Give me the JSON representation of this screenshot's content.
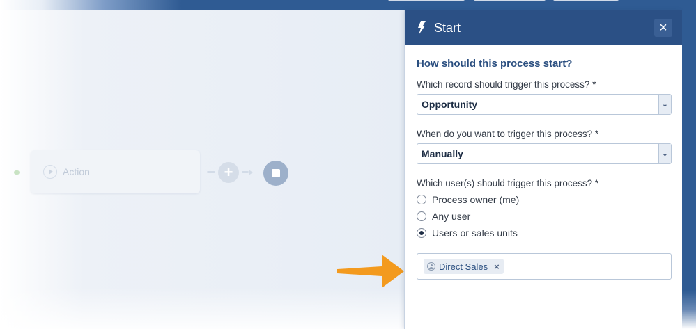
{
  "canvas": {
    "action_label": "Action"
  },
  "panel": {
    "title": "Start",
    "close_label": "×",
    "heading": "How should this process start?",
    "record_label": "Which record should trigger this process? *",
    "record_value": "Opportunity",
    "when_label": "When do you want to trigger this process? *",
    "when_value": "Manually",
    "users_label": "Which user(s) should trigger this process? *",
    "user_options": [
      {
        "label": "Process owner (me)",
        "checked": false
      },
      {
        "label": "Any user",
        "checked": false
      },
      {
        "label": "Users or sales units",
        "checked": true
      }
    ],
    "selected_tags": [
      "Direct Sales"
    ],
    "tag_remove": "×"
  },
  "colors": {
    "header": "#2b5085",
    "accent_text": "#2b4f80",
    "callout": "#f39a1e"
  },
  "icons": {
    "header_icon": "lightning-bolt-icon",
    "close_icon": "close-icon",
    "dropdown_icon": "chevron-down-icon",
    "tag_icon": "user-icon",
    "action_icon": "play-circle-icon",
    "end_icon": "stop-icon",
    "add_icon": "plus-icon"
  }
}
